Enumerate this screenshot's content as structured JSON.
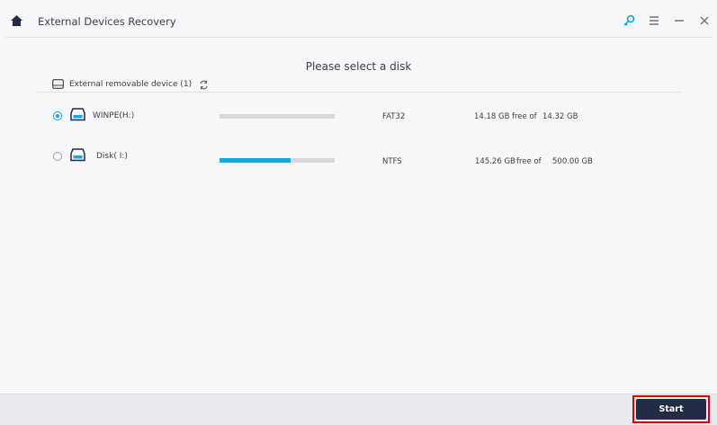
{
  "window": {
    "title": "External Devices Recovery",
    "accent": "#1aa3dd",
    "icons": [
      "home-icon",
      "key-icon",
      "menu-icon",
      "minimize-icon",
      "close-icon"
    ]
  },
  "main": {
    "heading": "Please select a disk",
    "group": {
      "label": "External removable device (1)"
    },
    "disks": [
      {
        "name": "WINPE(H:)",
        "selected": true,
        "used_fraction": 0.01,
        "fs": "FAT32",
        "free": "14.18 GB",
        "free_of": "free of",
        "total": "14.32 GB"
      },
      {
        "name": "Disk( I:)",
        "selected": false,
        "used_fraction": 0.62,
        "fs": "NTFS",
        "free": "145.26 GB",
        "free_of": "free of",
        "total": "500.00 GB"
      }
    ]
  },
  "footer": {
    "start_label": "Start"
  }
}
